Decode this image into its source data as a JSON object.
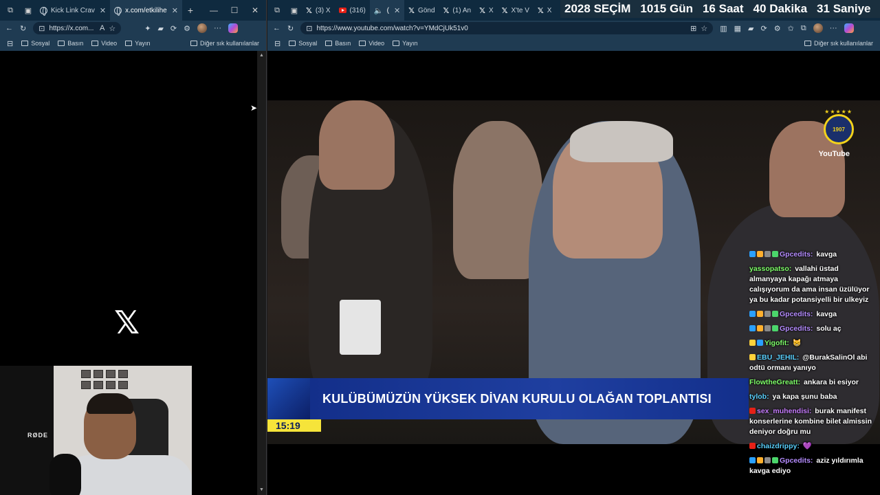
{
  "left_window": {
    "tabs": [
      {
        "label": "Kick Link Crav",
        "icon": "globe-icon",
        "active": false
      },
      {
        "label": "x.com/etkilihe",
        "icon": "globe-icon",
        "active": true
      }
    ],
    "url": "https://x.com...",
    "bookmarks": [
      "Sosyal",
      "Basın",
      "Video",
      "Yayın"
    ],
    "bookmarks_other": "Diğer sık kullanılanlar",
    "page_logo": "𝕏"
  },
  "right_window": {
    "tabs": [
      {
        "label": "(3) X",
        "icon": "x-icon"
      },
      {
        "label": "(316)",
        "icon": "youtube-icon"
      },
      {
        "label": "(",
        "icon": "speaker-icon"
      },
      {
        "label": "Gönd",
        "icon": "x-icon"
      },
      {
        "label": "(1) An",
        "icon": "x-icon"
      },
      {
        "label": "X",
        "icon": "x-icon"
      },
      {
        "label": "X'te V",
        "icon": "x-icon"
      },
      {
        "label": "X",
        "icon": "x-icon"
      }
    ],
    "url": "https://www.youtube.com/watch?v=YMdCjUk51v0",
    "bookmarks": [
      "Sosyal",
      "Basın",
      "Video",
      "Yayın"
    ],
    "bookmarks_other": "Diğer sık kullanılanlar"
  },
  "countdown": {
    "year": "2028",
    "label": "SEÇİM",
    "days": "1015",
    "days_unit": "Gün",
    "hours": "16",
    "hours_unit": "Saat",
    "minutes": "40",
    "minutes_unit": "Dakika",
    "seconds": "31",
    "seconds_unit": "Saniye"
  },
  "video": {
    "banner": "KULÜBÜMÜZÜN YÜKSEK DİVAN KURULU OLAĞAN TOPLANTISI",
    "clock": "15:19",
    "channel_badge": "YouTube",
    "logo_year": "1907"
  },
  "webcam": {
    "mic_brand": "RØDE"
  },
  "chat": [
    {
      "user": "Gpcedits",
      "user_color": "#b58cff",
      "text": "kavga",
      "badges": [
        "#2aa0ff",
        "#ffb02e",
        "#8a8a8a",
        "#4bd66b"
      ]
    },
    {
      "user": "yassopatso",
      "user_color": "#7fff6a",
      "text": "vallahi üstad almanyaya kapağı atmaya calışıyorum da ama insan üzülüyor ya bu kadar potansiyelli bir ulkeyiz",
      "badges": []
    },
    {
      "user": "Gpcedits",
      "user_color": "#b58cff",
      "text": "kavga",
      "badges": [
        "#2aa0ff",
        "#ffb02e",
        "#8a8a8a",
        "#4bd66b"
      ]
    },
    {
      "user": "Gpcedits",
      "user_color": "#b58cff",
      "text": "solu aç",
      "badges": [
        "#2aa0ff",
        "#ffb02e",
        "#8a8a8a",
        "#4bd66b"
      ]
    },
    {
      "user": "Yigofit",
      "user_color": "#7fff6a",
      "text": "😸",
      "badges": [
        "#ffd23a",
        "#2aa0ff"
      ]
    },
    {
      "user": "EBU_JEHIL",
      "user_color": "#5ad1ff",
      "text": "@BurakSalinOl abi odtü ormanı yanıyo",
      "badges": [
        "#ffd23a"
      ]
    },
    {
      "user": "FlowtheGreatt",
      "user_color": "#7fff6a",
      "text": "ankara bi esiyor",
      "badges": []
    },
    {
      "user": "tylob",
      "user_color": "#5ad1ff",
      "text": "ya kapa şunu baba",
      "badges": []
    },
    {
      "user": "sex_muhendisi",
      "user_color": "#c77dff",
      "text": "burak manifest konserlerine kombine bilet almissin deniyor doğru mu",
      "badges": [
        "#e62117"
      ]
    },
    {
      "user": "chaizdrippy",
      "user_color": "#5ad1ff",
      "text": "💜",
      "badges": [
        "#e62117"
      ]
    },
    {
      "user": "Gpcedits",
      "user_color": "#b58cff",
      "text": "aziz yıldırımla kavga ediyo",
      "badges": [
        "#2aa0ff",
        "#ffb02e",
        "#8a8a8a",
        "#4bd66b"
      ]
    }
  ]
}
